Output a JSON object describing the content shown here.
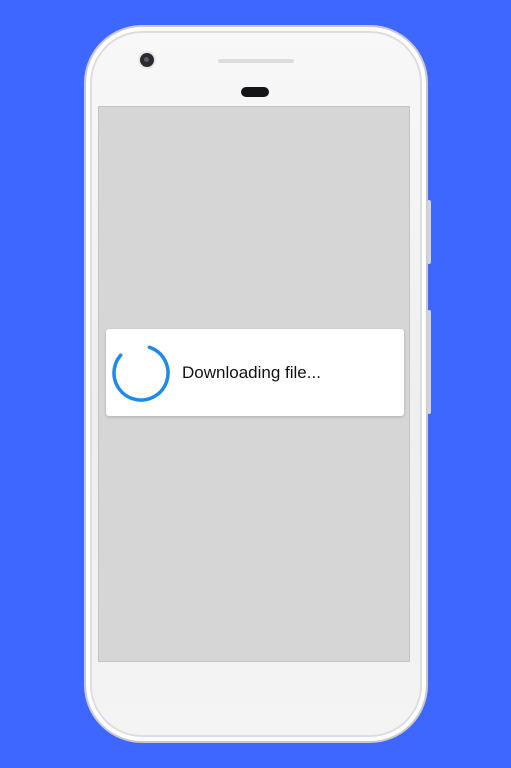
{
  "dialog": {
    "message": "Downloading file...",
    "spinner_icon": "progress-spinner-icon",
    "accent_color": "#1f8be8"
  },
  "colors": {
    "background": "#3d67ff",
    "screen_overlay": "#d6d6d7",
    "dialog_background": "#ffffff"
  }
}
